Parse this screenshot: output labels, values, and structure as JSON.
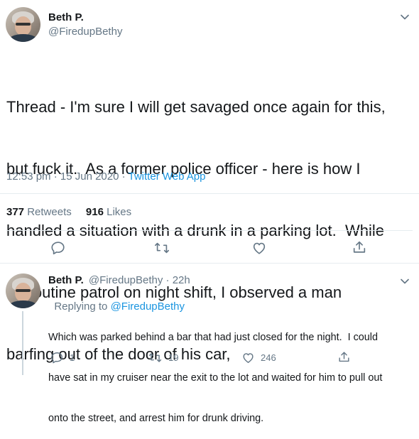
{
  "main_tweet": {
    "name": "Beth P.",
    "handle": "@FiredupBethy",
    "text_lines": [
      "Thread - I'm sure I will get savaged once again for this,",
      "but fuck it.  As a former police officer - here is how I",
      "handled a situation with a drunk in a parking lot.  While",
      "on routine patrol on night shift, I observed a man",
      "barfing out of the door of his car,"
    ],
    "time": "12:53 pm · 15 Jun 2020 · ",
    "source": "Twitter Web App",
    "retweets_count": "377",
    "retweets_label": "Retweets",
    "likes_count": "916",
    "likes_label": "Likes"
  },
  "reply_tweet": {
    "name": "Beth P.",
    "handle_time": "@FiredupBethy · 22h",
    "replying_prefix": "Replying to ",
    "replying_to": "@FiredupBethy",
    "text_lines": [
      "Which was parked behind a bar that had just closed for the night.  I could",
      "have sat in my cruiser near the exit to the lot and waited for him to pull out",
      "onto the street, and arrest him for drunk driving."
    ],
    "reply_count": "1",
    "retweet_count": "19",
    "like_count": "246"
  },
  "colors": {
    "text": "#14171a",
    "muted": "#657786",
    "link": "#1b95e0",
    "divider": "#e6ecf0",
    "thread_line": "#ccd6dd"
  },
  "icons": [
    "chevron-down-icon",
    "reply-icon",
    "retweet-icon",
    "like-icon",
    "share-icon"
  ]
}
